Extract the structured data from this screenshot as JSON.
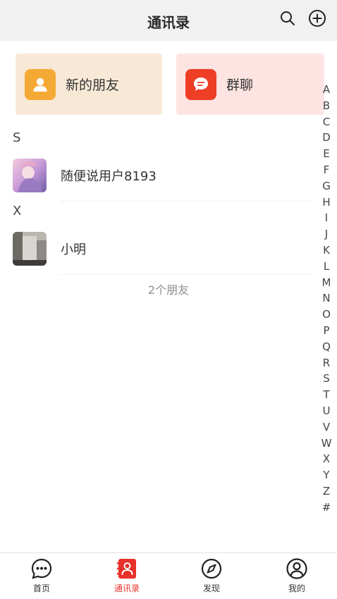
{
  "header": {
    "title": "通讯录"
  },
  "cards": {
    "new_friends": {
      "label": "新的朋友",
      "icon": "person-icon"
    },
    "group_chat": {
      "label": "群聊",
      "icon": "chat-bubble-icon"
    }
  },
  "sections": [
    {
      "letter": "S",
      "contacts": [
        {
          "name": "随便说用户8193"
        }
      ]
    },
    {
      "letter": "X",
      "contacts": [
        {
          "name": "小明"
        }
      ]
    }
  ],
  "friend_count": "2个朋友",
  "index_letters": [
    "A",
    "B",
    "C",
    "D",
    "E",
    "F",
    "G",
    "H",
    "I",
    "J",
    "K",
    "L",
    "M",
    "N",
    "O",
    "P",
    "Q",
    "R",
    "S",
    "T",
    "U",
    "V",
    "W",
    "X",
    "Y",
    "Z",
    "#"
  ],
  "tabbar": {
    "tabs": [
      {
        "label": "首页",
        "icon": "chat-dots-icon",
        "active": false
      },
      {
        "label": "通讯录",
        "icon": "contacts-book-icon",
        "active": true
      },
      {
        "label": "发现",
        "icon": "compass-icon",
        "active": false
      },
      {
        "label": "我的",
        "icon": "profile-icon",
        "active": false
      }
    ]
  },
  "colors": {
    "accent": "#e8312a",
    "friends_card_bg": "#f8e9d6",
    "groups_card_bg": "#fde4e2",
    "friends_icon": "#f5a935",
    "groups_icon": "#ee3e26"
  }
}
